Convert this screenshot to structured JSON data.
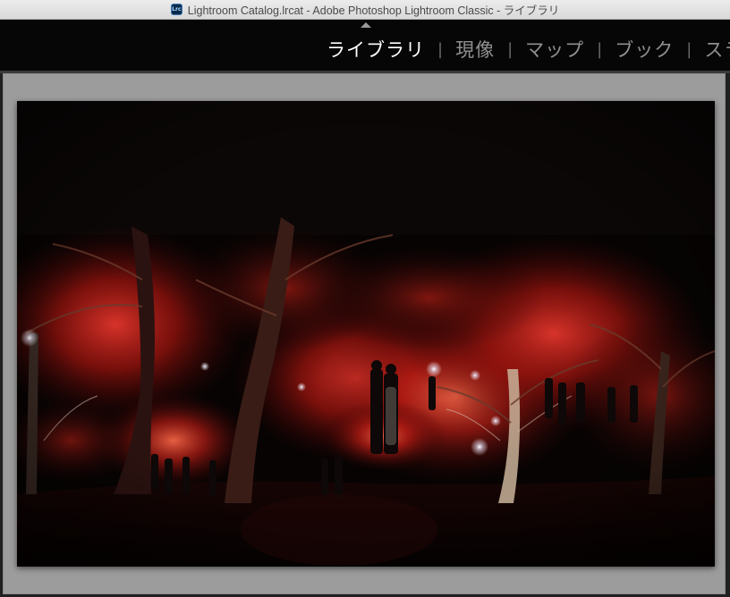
{
  "window": {
    "title": "Lightroom Catalog.lrcat - Adobe Photoshop Lightroom Classic - ライブラリ",
    "app_icon_text": "Lrc"
  },
  "modules": {
    "items": [
      {
        "label": "ライブラリ",
        "active": true
      },
      {
        "label": "現像",
        "active": false
      },
      {
        "label": "マップ",
        "active": false
      },
      {
        "label": "ブック",
        "active": false
      },
      {
        "label": "スライ",
        "active": false
      }
    ],
    "separator": "|"
  },
  "colors": {
    "module_active": "#ffffff",
    "module_inactive": "#8f8f8f",
    "background_panel": "#9c9c9c",
    "foliage_red": "#c8201c"
  },
  "icons": {
    "app": "lightroom-classic-app-icon",
    "panel_toggle": "triangle-up-icon"
  }
}
